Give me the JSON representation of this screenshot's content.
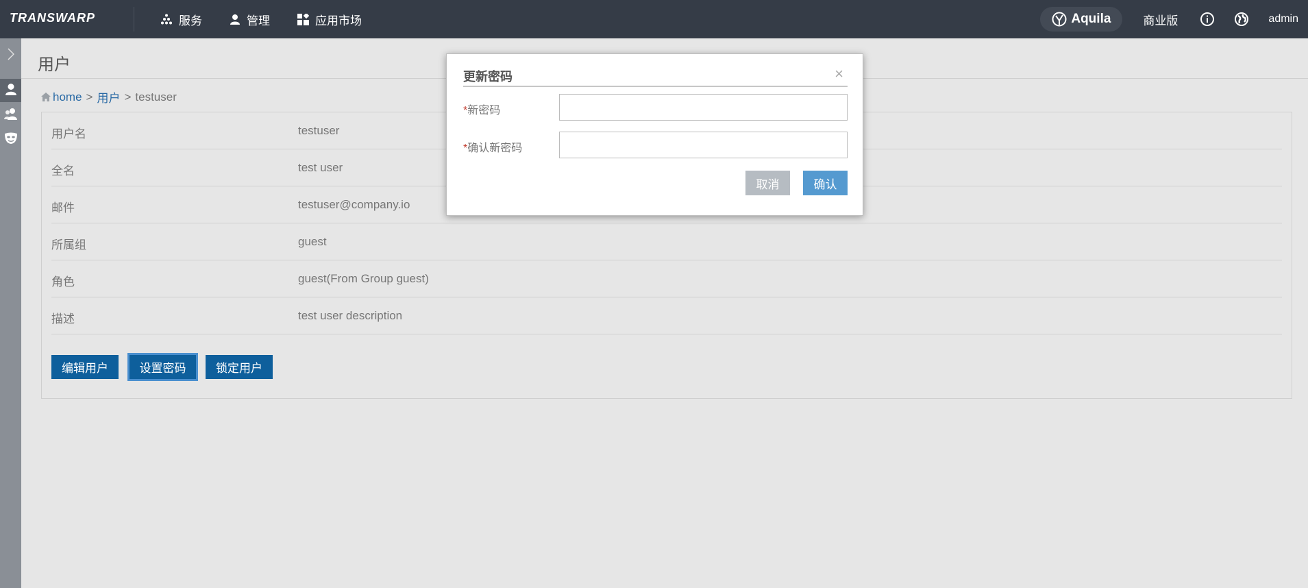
{
  "topbar": {
    "logo": "TRANSWARP",
    "nav": [
      {
        "label": "服务",
        "icon": "cluster-dots-icon"
      },
      {
        "label": "管理",
        "icon": "person-icon"
      },
      {
        "label": "应用市场",
        "icon": "apps-grid-icon"
      }
    ],
    "aquila": "Aquila",
    "edition": "商业版",
    "user": "admin"
  },
  "sidebar": {
    "items": [
      {
        "icon": "chevron-right-icon"
      },
      {
        "icon": "user-icon"
      },
      {
        "icon": "users-group-icon"
      },
      {
        "icon": "mask-icon"
      }
    ]
  },
  "page": {
    "title": "用户",
    "breadcrumb": {
      "home": "home",
      "sep1": ">",
      "users": "用户",
      "sep2": ">",
      "current": "testuser"
    }
  },
  "details": [
    {
      "label": "用户名",
      "value": "testuser"
    },
    {
      "label": "全名",
      "value": "test user"
    },
    {
      "label": "邮件",
      "value": "testuser@company.io"
    },
    {
      "label": "所属组",
      "value": "guest"
    },
    {
      "label": "角色",
      "value": "guest(From Group guest)"
    },
    {
      "label": "描述",
      "value": "test user description"
    }
  ],
  "actions": {
    "edit": "编辑用户",
    "set_password": "设置密码",
    "lock": "锁定用户"
  },
  "modal": {
    "title": "更新密码",
    "close": "×",
    "required_mark": "*",
    "new_password_label": "新密码",
    "confirm_password_label": "确认新密码",
    "new_password_value": "",
    "confirm_password_value": "",
    "cancel": "取消",
    "ok": "确认"
  }
}
